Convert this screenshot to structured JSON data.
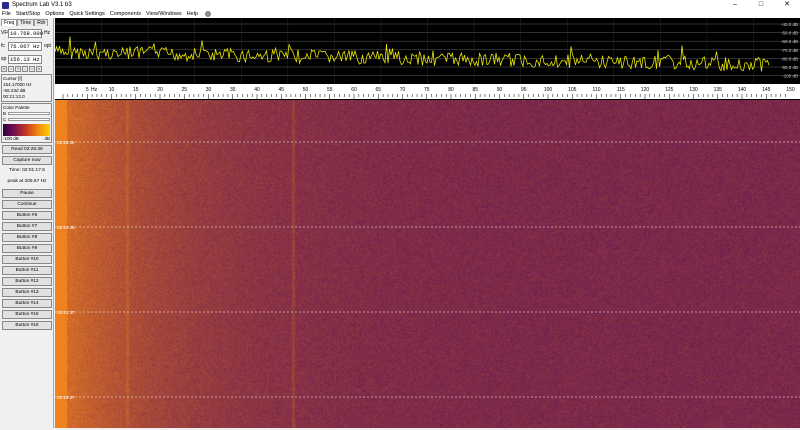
{
  "window": {
    "title": "Spectrum Lab V3.1 b3"
  },
  "menu": [
    "File",
    "Start/Stop",
    "Options",
    "Quick Settings",
    "Components",
    "View/Windows",
    "Help"
  ],
  "tabs": [
    "Freq",
    "Time",
    "Rdr"
  ],
  "freq_fields": [
    {
      "label": "VFO",
      "value": "10.768.000",
      "unit": "Hz"
    },
    {
      "label": "fc",
      "value": "76.067 Hz",
      "unit": "opt"
    },
    {
      "label": "sp",
      "value": "156.13 Hz",
      "unit": ""
    }
  ],
  "cursor": {
    "title": "Cursor [f]",
    "freq": "154.17000 Hz",
    "level": "-56.23d dB",
    "time": "00:21:13.0"
  },
  "palette": {
    "title": "Color Palette",
    "b_label": "B",
    "c_label": "C",
    "min": "-100 dB",
    "max": "dB"
  },
  "buttons": {
    "read": "Read 02:25:38",
    "capture": "Capture now",
    "time": "Time: 02:01:17.5",
    "peak": "peak at 205.67 Hz",
    "pause": "Pause",
    "continue": "Continue",
    "custom": [
      "Button #6",
      "Button #7",
      "Button #8",
      "Button #9",
      "Button #10",
      "Button #11",
      "Button #12",
      "Button #13",
      "Button #14",
      "Button #15",
      "Button #16"
    ]
  },
  "db_labels": [
    "-40.0 dB",
    "-50.0 dB",
    "-60.0 dB",
    "-70.0 dB",
    "-80.0 dB",
    "-90.0 dB",
    "-100 dB"
  ],
  "freq_ticks": [
    "5",
    "10",
    "15",
    "20",
    "25",
    "30",
    "35",
    "40",
    "45",
    "50",
    "55",
    "60",
    "65",
    "70",
    "75",
    "80",
    "85",
    "90",
    "95",
    "100",
    "105",
    "110",
    "115",
    "120",
    "125",
    "130",
    "135",
    "140",
    "145",
    "150"
  ],
  "freq_unit": "Hz",
  "waterfall_times": [
    "02:25:38",
    "02:23:38",
    "02:21:37",
    "02:19:37"
  ],
  "colors": {
    "trace": "#e8e800",
    "grid": "#606060",
    "waterfall_bg": "#7a2a55",
    "waterfall_hot": "#e08020"
  }
}
